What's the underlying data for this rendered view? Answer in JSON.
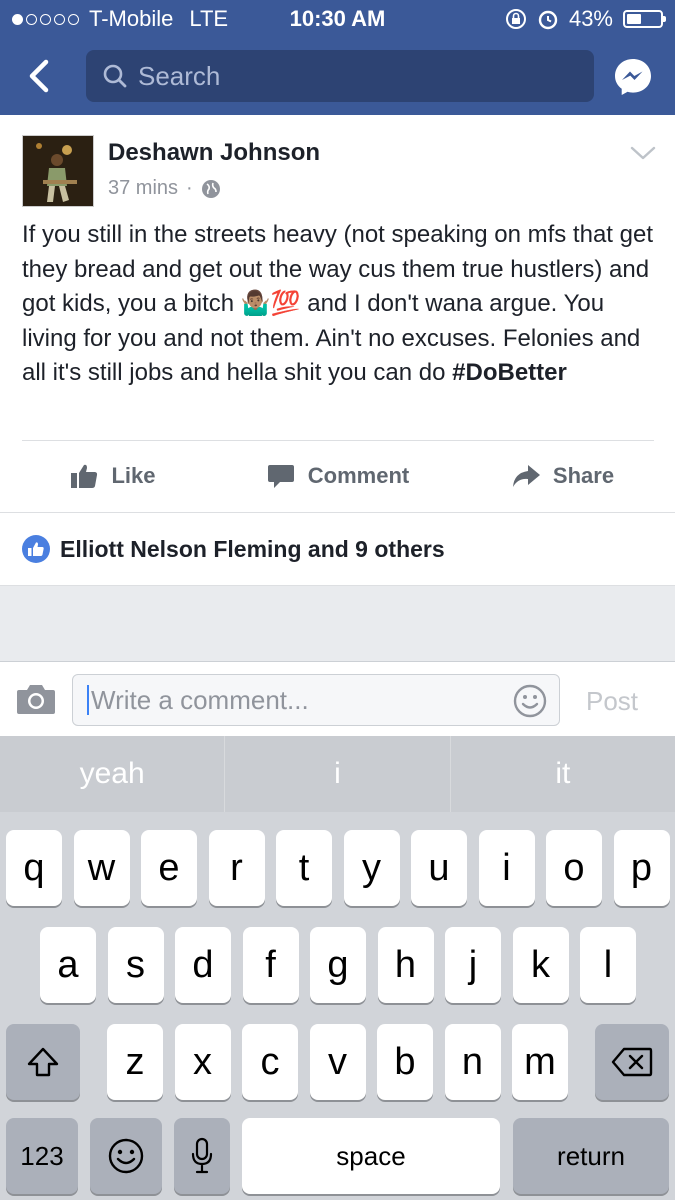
{
  "status_bar": {
    "carrier": "T-Mobile",
    "network": "LTE",
    "time": "10:30 AM",
    "battery_percent_label": "43%",
    "battery_level": 0.43,
    "signal_bars": 1
  },
  "header": {
    "search_placeholder": "Search",
    "icons": [
      "back-icon",
      "search-icon",
      "messenger-icon"
    ]
  },
  "post": {
    "author": "Deshawn Johnson",
    "time": "37 mins",
    "separator": "·",
    "text_1": "If you still in the streets heavy (not speaking on mfs that get they bread and get out the way cus them true hustlers) and got kids, you a bitch",
    "emoji": "🤷🏽‍♂️💯",
    "text_2": " and I don't wana argue. You living for you and not them. Ain't no excuses. Felonies and all it's still jobs and hella shit you can do ",
    "hashtag": "#DoBetter",
    "actions": {
      "like": "Like",
      "comment": "Comment",
      "share": "Share"
    }
  },
  "likes": {
    "text": "Elliott Nelson Fleming and 9 others"
  },
  "composer": {
    "placeholder": "Write a comment...",
    "post_label": "Post"
  },
  "keyboard": {
    "suggestions": [
      "yeah",
      "i",
      "it"
    ],
    "row1": [
      "q",
      "w",
      "e",
      "r",
      "t",
      "y",
      "u",
      "i",
      "o",
      "p"
    ],
    "row2": [
      "a",
      "s",
      "d",
      "f",
      "g",
      "h",
      "j",
      "k",
      "l"
    ],
    "row3": [
      "z",
      "x",
      "c",
      "v",
      "b",
      "n",
      "m"
    ],
    "numbers_label": "123",
    "space_label": "space",
    "return_label": "return"
  },
  "colors": {
    "brand": "#3b5998",
    "like_blue": "#4a7fe0",
    "muted": "#90949c"
  }
}
